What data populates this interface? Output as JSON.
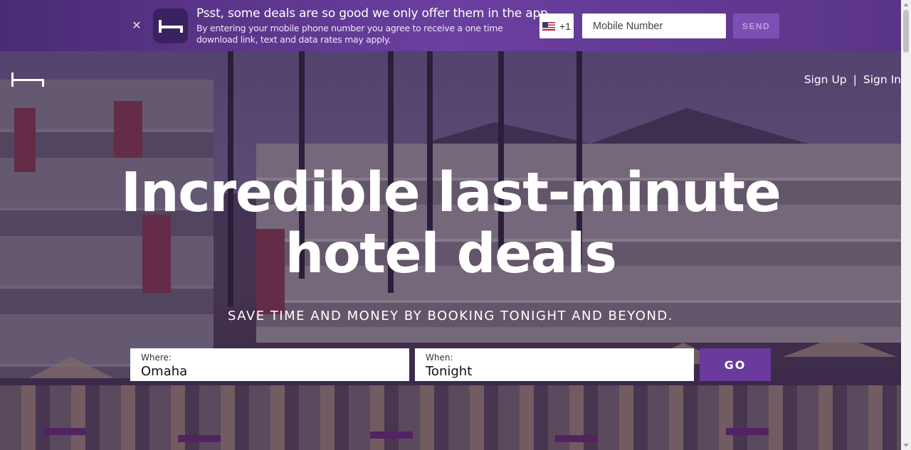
{
  "banner": {
    "close_icon": "close-icon",
    "title": "Psst, some deals are so good we only offer them in the app",
    "subtitle": "By entering your mobile phone number you agree to receive a one time download link, text and data rates may apply.",
    "country_code": "+1",
    "phone_placeholder": "Mobile Number",
    "send_label": "SEND",
    "send_color": "#7d4fb5"
  },
  "header": {
    "logo_icon": "bed-logo-icon",
    "sign_up": "Sign Up",
    "separator": "|",
    "sign_in": "Sign In"
  },
  "hero": {
    "headline_line1": "Incredible last-minute",
    "headline_line2": "hotel deals",
    "subhead": "SAVE TIME AND MONEY BY BOOKING TONIGHT AND BEYOND."
  },
  "search": {
    "where_label": "Where:",
    "where_value": "Omaha",
    "when_label": "When:",
    "when_value": "Tonight",
    "go_label": "GO",
    "accent_color": "#6a3a9c"
  }
}
